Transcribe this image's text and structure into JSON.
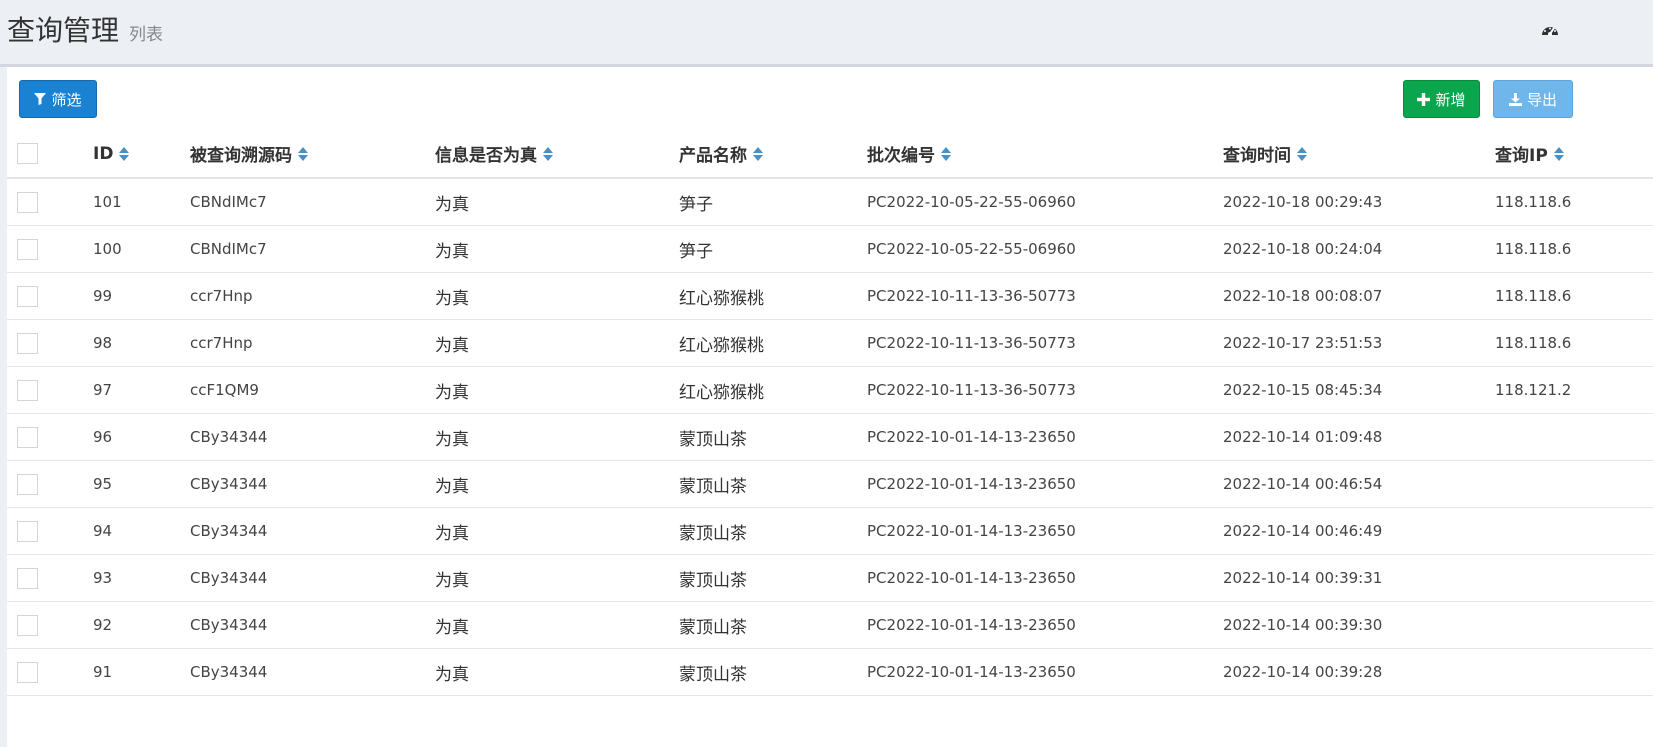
{
  "header": {
    "title": "查询管理",
    "subtitle": "列表",
    "dashboard_icon": "dashboard-icon"
  },
  "toolbar": {
    "filter_label": "筛选",
    "filter_icon": "filter-icon",
    "add_label": "新增",
    "add_icon": "plus-icon",
    "export_label": "导出",
    "export_icon": "download-icon"
  },
  "colors": {
    "background": "#ecf0f5",
    "primary": "#1b82d2",
    "success": "#0aa54d",
    "export": "#6fb7ea",
    "sort_icon": "#4a90c2"
  },
  "table": {
    "columns": [
      {
        "label": "ID"
      },
      {
        "label": "被查询溯源码"
      },
      {
        "label": "信息是否为真"
      },
      {
        "label": "产品名称"
      },
      {
        "label": "批次编号"
      },
      {
        "label": "查询时间"
      },
      {
        "label": "查询IP"
      }
    ],
    "rows": [
      {
        "id": "101",
        "code": "CBNdIMc7",
        "is_real": "为真",
        "product": "笋子",
        "batch": "PC2022-10-05-22-55-06960",
        "time": "2022-10-18 00:29:43",
        "ip": "118.118.6"
      },
      {
        "id": "100",
        "code": "CBNdIMc7",
        "is_real": "为真",
        "product": "笋子",
        "batch": "PC2022-10-05-22-55-06960",
        "time": "2022-10-18 00:24:04",
        "ip": "118.118.6"
      },
      {
        "id": "99",
        "code": "ccr7Hnp",
        "is_real": "为真",
        "product": "红心猕猴桃",
        "batch": "PC2022-10-11-13-36-50773",
        "time": "2022-10-18 00:08:07",
        "ip": "118.118.6"
      },
      {
        "id": "98",
        "code": "ccr7Hnp",
        "is_real": "为真",
        "product": "红心猕猴桃",
        "batch": "PC2022-10-11-13-36-50773",
        "time": "2022-10-17 23:51:53",
        "ip": "118.118.6"
      },
      {
        "id": "97",
        "code": "ccF1QM9",
        "is_real": "为真",
        "product": "红心猕猴桃",
        "batch": "PC2022-10-11-13-36-50773",
        "time": "2022-10-15 08:45:34",
        "ip": "118.121.2"
      },
      {
        "id": "96",
        "code": "CBy34344",
        "is_real": "为真",
        "product": "蒙顶山茶",
        "batch": "PC2022-10-01-14-13-23650",
        "time": "2022-10-14 01:09:48",
        "ip": ""
      },
      {
        "id": "95",
        "code": "CBy34344",
        "is_real": "为真",
        "product": "蒙顶山茶",
        "batch": "PC2022-10-01-14-13-23650",
        "time": "2022-10-14 00:46:54",
        "ip": ""
      },
      {
        "id": "94",
        "code": "CBy34344",
        "is_real": "为真",
        "product": "蒙顶山茶",
        "batch": "PC2022-10-01-14-13-23650",
        "time": "2022-10-14 00:46:49",
        "ip": ""
      },
      {
        "id": "93",
        "code": "CBy34344",
        "is_real": "为真",
        "product": "蒙顶山茶",
        "batch": "PC2022-10-01-14-13-23650",
        "time": "2022-10-14 00:39:31",
        "ip": ""
      },
      {
        "id": "92",
        "code": "CBy34344",
        "is_real": "为真",
        "product": "蒙顶山茶",
        "batch": "PC2022-10-01-14-13-23650",
        "time": "2022-10-14 00:39:30",
        "ip": ""
      },
      {
        "id": "91",
        "code": "CBy34344",
        "is_real": "为真",
        "product": "蒙顶山茶",
        "batch": "PC2022-10-01-14-13-23650",
        "time": "2022-10-14 00:39:28",
        "ip": ""
      }
    ]
  }
}
